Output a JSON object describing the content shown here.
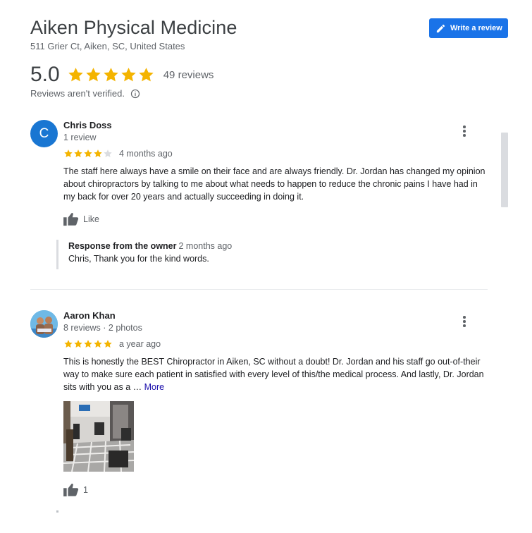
{
  "business": {
    "name": "Aiken Physical Medicine",
    "address": "511 Grier Ct, Aiken, SC, United States",
    "rating": "5.0",
    "review_count": "49 reviews",
    "not_verified": "Reviews aren't verified.",
    "overall_stars": 5
  },
  "write_review_label": "Write a review",
  "colors": {
    "accent": "#1a73e8",
    "star": "#f4b400",
    "star_empty": "#dadce0",
    "link": "#1a0dab"
  },
  "reviews": [
    {
      "avatar_letter": "C",
      "name": "Chris Doss",
      "meta": "1 review",
      "stars": 4,
      "time": "4 months ago",
      "text": "The staff here always have a smile on their face and are always friendly. Dr. Jordan has changed my opinion about chiropractors by talking to me about what needs to happen to reduce the chronic pains I have had in my back for over 20 years and actually succeeding in doing it.",
      "like_label": "Like",
      "owner_response": {
        "label": "Response from the owner",
        "time": "2 months ago",
        "text": "Chris, Thank you for the kind words."
      }
    },
    {
      "name": "Aaron Khan",
      "meta": "8 reviews · 2 photos",
      "stars": 5,
      "time": "a year ago",
      "text": "This is honestly the BEST Chiropractor in Aiken, SC without a doubt! Dr. Jordan and his staff go out-of-their way to make sure each patient in satisfied with every level of this/the medical process. And lastly, Dr. Jordan sits with you as a … ",
      "more_label": "More",
      "like_count": "1"
    }
  ]
}
